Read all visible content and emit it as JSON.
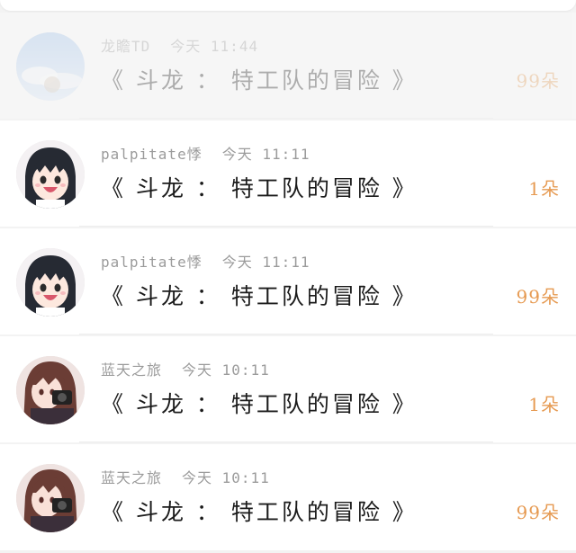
{
  "list": {
    "items": [
      {
        "user": "龙瞻TD",
        "time": "今天 11:44",
        "title": "《 斗龙 ： 特工队的冒险 》",
        "count": "99朵",
        "avatar": "sky-avatar"
      },
      {
        "user": "palpitate悸",
        "time": "今天 11:11",
        "title": "《 斗龙 ： 特工队的冒险 》",
        "count": "1朵",
        "avatar": "anime-girl-black-hair-avatar"
      },
      {
        "user": "palpitate悸",
        "time": "今天 11:11",
        "title": "《 斗龙 ： 特工队的冒险 》",
        "count": "99朵",
        "avatar": "anime-girl-black-hair-avatar"
      },
      {
        "user": "蓝天之旅",
        "time": "今天 10:11",
        "title": "《 斗龙 ： 特工队的冒险 》",
        "count": "1朵",
        "avatar": "anime-girl-brown-hair-avatar"
      },
      {
        "user": "蓝天之旅",
        "time": "今天 10:11",
        "title": "《 斗龙 ： 特工队的冒险 》",
        "count": "99朵",
        "avatar": "anime-girl-brown-hair-avatar"
      }
    ]
  },
  "colors": {
    "accent": "#e69a52",
    "meta": "#9b9b9b",
    "title": "#1b1b1b"
  }
}
